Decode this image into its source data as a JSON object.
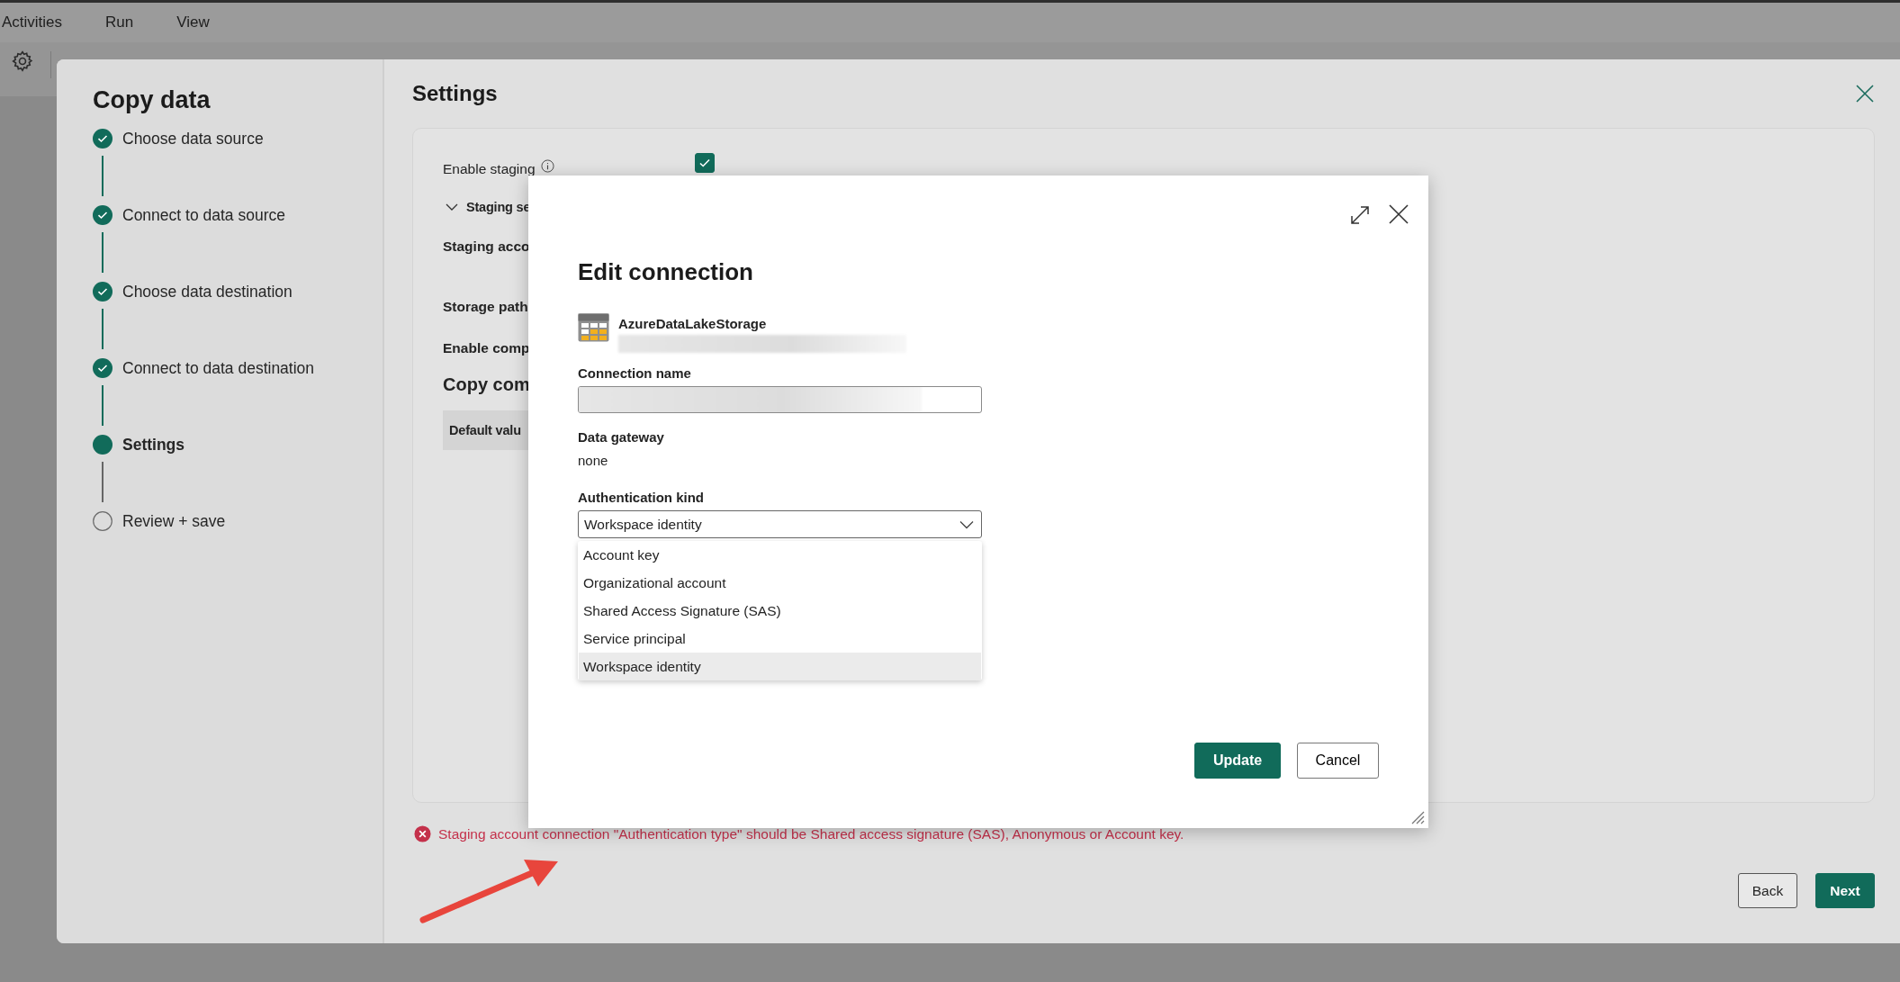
{
  "menu": [
    "Activities",
    "Run",
    "View"
  ],
  "wizard": {
    "title": "Copy data",
    "steps": [
      {
        "label": "Choose data source",
        "completed": true,
        "selected": false
      },
      {
        "label": "Connect to data source",
        "completed": true,
        "selected": false
      },
      {
        "label": "Choose data destination",
        "completed": true,
        "selected": false
      },
      {
        "label": "Connect to data destination",
        "completed": true,
        "selected": false
      },
      {
        "label": "Settings",
        "completed": false,
        "selected": true
      },
      {
        "label": "Review + save",
        "completed": false,
        "selected": false
      }
    ]
  },
  "settings": {
    "title": "Settings",
    "rows": [
      {
        "kind": "checkbox",
        "label": "Enable staging",
        "checked": true
      },
      {
        "kind": "section",
        "label": "Staging se",
        "expanded": true
      },
      {
        "kind": "label",
        "label": "Staging acco"
      },
      {
        "kind": "label",
        "label": "Storage path"
      },
      {
        "kind": "label",
        "label": "Enable comp"
      },
      {
        "kind": "heading",
        "label": "Copy com"
      },
      {
        "kind": "tab",
        "label": "Default valu"
      }
    ],
    "error": "Staging account connection \"Authentication type\" should be Shared access signature (SAS), Anonymous or Account key.",
    "buttons": [
      {
        "label": "Back",
        "kind": "secondary"
      },
      {
        "label": "Next",
        "kind": "primary"
      }
    ]
  },
  "dialog": {
    "title": "Edit connection",
    "connector": "AzureDataLakeStorage",
    "connection_name": {
      "label": "Connection name"
    },
    "data_gateway": {
      "label": "Data gateway",
      "value": "none"
    },
    "authentication": {
      "label": "Authentication kind",
      "value": "Workspace identity",
      "expanded": true,
      "options": [
        {
          "label": "Account key",
          "selected": false
        },
        {
          "label": "Organizational account",
          "selected": false
        },
        {
          "label": "Shared Access Signature (SAS)",
          "selected": false
        },
        {
          "label": "Service principal",
          "selected": false
        },
        {
          "label": "Workspace identity",
          "selected": true
        }
      ]
    },
    "buttons": [
      {
        "label": "Update",
        "kind": "primary"
      },
      {
        "label": "Cancel",
        "kind": "secondary"
      }
    ]
  }
}
